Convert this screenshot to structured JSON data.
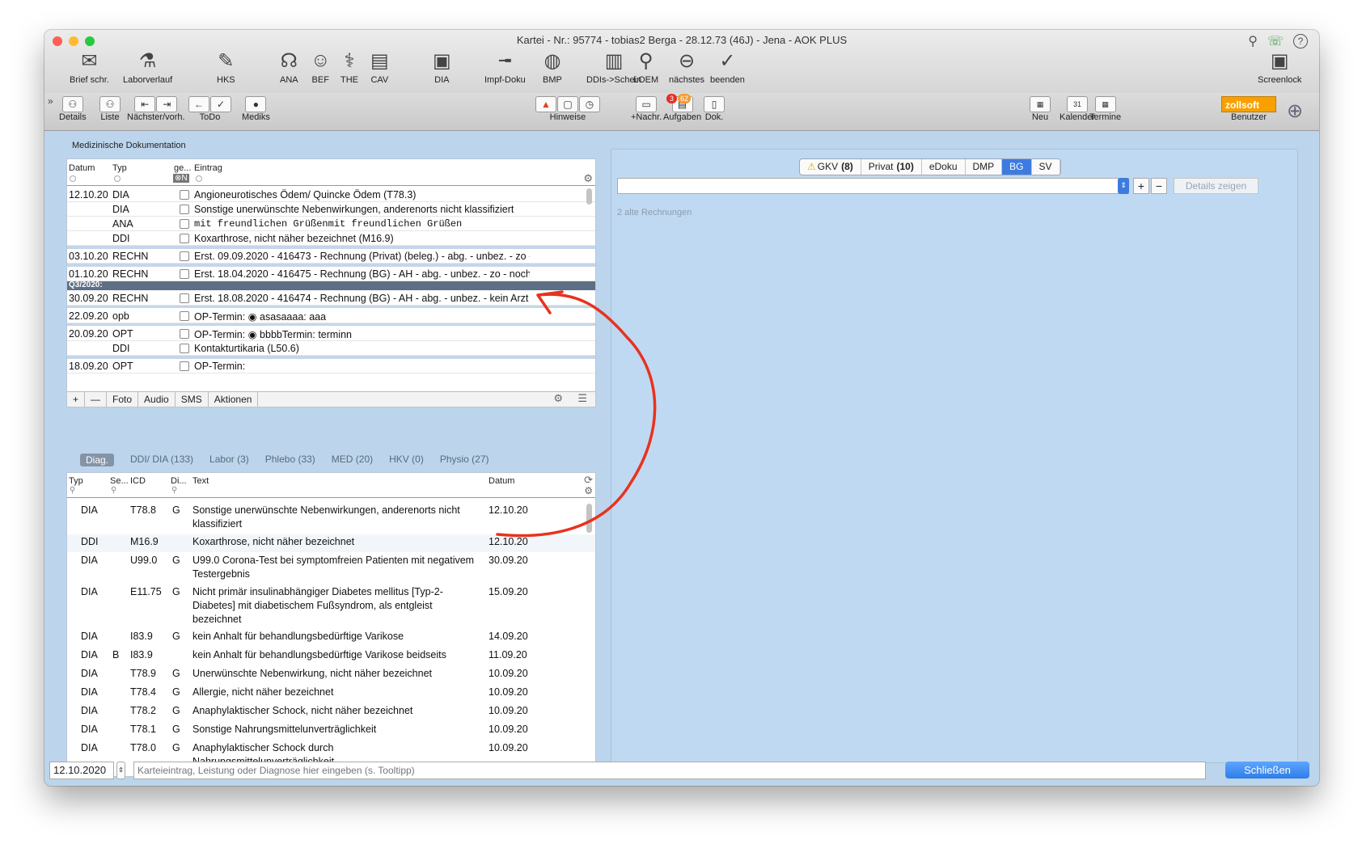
{
  "window": {
    "title": "Kartei - Nr.: 95774 - tobias2 Berga - 28.12.73 (46J) - Jena - AOK PLUS"
  },
  "toolbar": [
    {
      "label": "Brief schr.",
      "icon": "envelope-plus-icon",
      "glyph": "✉"
    },
    {
      "label": "Laborverlauf",
      "icon": "flask-icon",
      "glyph": "⚗"
    },
    {
      "label": "HKS",
      "icon": "pen-document-icon",
      "glyph": "✎"
    },
    {
      "label": "ANA",
      "icon": "stethoscope-icon",
      "glyph": "☊"
    },
    {
      "label": "BEF",
      "icon": "doctor-icon",
      "glyph": "☺"
    },
    {
      "label": "THE",
      "icon": "treatment-icon",
      "glyph": "⚕"
    },
    {
      "label": "CAV",
      "icon": "register-icon",
      "glyph": "▤"
    },
    {
      "label": "DIA",
      "icon": "clipboard-icon",
      "glyph": "▣"
    },
    {
      "label": "Impf-Doku",
      "icon": "syringe-icon",
      "glyph": "╼"
    },
    {
      "label": "BMP",
      "icon": "pill-icon",
      "glyph": "◍"
    },
    {
      "label": "DDIs->Schein",
      "icon": "document-icon",
      "glyph": "▥"
    },
    {
      "label": "LOEM",
      "icon": "microscope-icon",
      "glyph": "⚲"
    },
    {
      "label": "nächstes",
      "icon": "arrow-left-circle-icon",
      "glyph": "⊖"
    },
    {
      "label": "beenden",
      "icon": "check-circle-icon",
      "glyph": "✓"
    }
  ],
  "screenlock": {
    "label": "Screenlock",
    "glyph": "▣"
  },
  "toolbar2": [
    {
      "label": "Details",
      "glyphs": [
        "⚇"
      ]
    },
    {
      "label": "Liste",
      "glyphs": [
        "⚇"
      ]
    },
    {
      "label": "Nächster/vorh.",
      "glyphs": [
        "⇤",
        "⇥"
      ]
    },
    {
      "label": "ToDo",
      "glyphs": [
        "←",
        "✓"
      ]
    },
    {
      "label": "Mediks",
      "glyphs": [
        "●"
      ]
    },
    {
      "label": "Hinweise",
      "glyphs": [
        "▲",
        "▢",
        "◷"
      ]
    },
    {
      "label": "+Nachr.",
      "glyphs": [
        "▭"
      ]
    },
    {
      "label": "Aufgaben",
      "glyphs": [
        "▤"
      ]
    },
    {
      "label": "Dok.",
      "glyphs": [
        "▯"
      ]
    }
  ],
  "badges": {
    "nachr": "3",
    "aufgaben": "62"
  },
  "toolbar2_right": [
    {
      "label": "Neu",
      "glyph": "▦"
    },
    {
      "label": "Kalender",
      "glyph": "31"
    },
    {
      "label": "Termine",
      "glyph": "▦"
    }
  ],
  "benutzer": {
    "name": "zollsoft",
    "label": "Benutzer"
  },
  "left_panel": {
    "title": "Medizinische Dokumentation",
    "columns": {
      "datum": "Datum",
      "typ": "Typ",
      "ge": "ge...",
      "entry": "Eintrag",
      "filter": "⊗N"
    },
    "rows": [
      {
        "date": "12.10.20",
        "typ": "DIA",
        "text": "Angioneurotisches Ödem/ Quincke Ödem (T78.3)",
        "mono": false
      },
      {
        "date": "",
        "typ": "DIA",
        "text": "Sonstige unerwünschte Nebenwirkungen, anderenorts nicht klassifiziert",
        "mono": false
      },
      {
        "date": "",
        "typ": "ANA",
        "text": "mit freundlichen Grüßenmit freundlichen Grüßen",
        "mono": true
      },
      {
        "date": "",
        "typ": "DDI",
        "text": "Koxarthrose, nicht näher bezeichnet (M16.9)",
        "mono": false
      },
      {
        "date": "03.10.20",
        "typ": "RECHN",
        "text": "Erst. 09.09.2020 - 416473 - Rechnung (Privat) (beleg.) - abg. - unbez. - zo -",
        "mono": false
      },
      {
        "date": "01.10.20",
        "typ": "RECHN",
        "text": "Erst. 18.04.2020 - 416475 - Rechnung (BG) - AH - abg. - unbez. - zo - noch",
        "mono": false
      },
      {
        "date": "30.09.20",
        "typ": "RECHN",
        "text": "Erst. 18.08.2020 - 416474 - Rechnung (BG) - AH - abg. - unbez. - kein Arzt -",
        "mono": false
      },
      {
        "date": "22.09.20",
        "typ": "opb",
        "text": "OP-Termin: ◉ asasaaaa: aaa",
        "mono": false
      },
      {
        "date": "20.09.20",
        "typ": "OPT",
        "text": "OP-Termin: ◉ bbbbTermin: terminn",
        "mono": false
      },
      {
        "date": "",
        "typ": "DDI",
        "text": "Kontakturtikaria (L50.6)",
        "mono": false
      },
      {
        "date": "18.09.20",
        "typ": "OPT",
        "text": "OP-Termin:",
        "mono": false
      }
    ],
    "quarter_label": "Q3/2020:",
    "bottom_bar": [
      "+",
      "—",
      "Foto",
      "Audio",
      "SMS",
      "Aktionen"
    ]
  },
  "diag_tabs": [
    "Diag.",
    "DDI/ DIA (133)",
    "Labor (3)",
    "Phlebo (33)",
    "MED (20)",
    "HKV (0)",
    "Physio (27)"
  ],
  "diag_table": {
    "columns": {
      "typ": "Typ",
      "se": "Se...",
      "icd": "ICD",
      "di": "Di...",
      "text": "Text",
      "datum": "Datum"
    },
    "rows": [
      {
        "typ": "DIA",
        "se": "",
        "icd": "T78.8",
        "di": "G",
        "text": "Sonstige unerwünschte Nebenwirkungen, anderenorts nicht klassifiziert",
        "date": "12.10.20",
        "lines": 2,
        "hl": false
      },
      {
        "typ": "DDI",
        "se": "",
        "icd": "M16.9",
        "di": "",
        "text": "Koxarthrose, nicht näher bezeichnet",
        "date": "12.10.20",
        "lines": 1,
        "hl": true
      },
      {
        "typ": "DIA",
        "se": "",
        "icd": "U99.0",
        "di": "G",
        "text": "U99.0 Corona-Test bei symptomfreien Patienten mit negativem Testergebnis",
        "date": "30.09.20",
        "lines": 2,
        "hl": false
      },
      {
        "typ": "DIA",
        "se": "",
        "icd": "E11.75",
        "di": "G",
        "text": "Nicht primär insulinabhängiger Diabetes mellitus [Typ-2-Diabetes] mit diabetischem Fußsyndrom, als entgleist bezeichnet",
        "date": "15.09.20",
        "lines": 3,
        "hl": false
      },
      {
        "typ": "DIA",
        "se": "",
        "icd": "I83.9",
        "di": "G",
        "text": "kein Anhalt für  behandlungsbedürftige Varikose",
        "date": "14.09.20",
        "lines": 1,
        "hl": false
      },
      {
        "typ": "DIA",
        "se": "B",
        "icd": "I83.9",
        "di": "",
        "text": "kein Anhalt für  behandlungsbedürftige Varikose beidseits",
        "date": "11.09.20",
        "lines": 1,
        "hl": false
      },
      {
        "typ": "DIA",
        "se": "",
        "icd": "T78.9",
        "di": "G",
        "text": "Unerwünschte Nebenwirkung, nicht näher bezeichnet",
        "date": "10.09.20",
        "lines": 1,
        "hl": false
      },
      {
        "typ": "DIA",
        "se": "",
        "icd": "T78.4",
        "di": "G",
        "text": "Allergie, nicht näher bezeichnet",
        "date": "10.09.20",
        "lines": 1,
        "hl": false
      },
      {
        "typ": "DIA",
        "se": "",
        "icd": "T78.2",
        "di": "G",
        "text": "Anaphylaktischer Schock, nicht näher bezeichnet",
        "date": "10.09.20",
        "lines": 1,
        "hl": false
      },
      {
        "typ": "DIA",
        "se": "",
        "icd": "T78.1",
        "di": "G",
        "text": "Sonstige Nahrungsmittelunverträglichkeit",
        "date": "10.09.20",
        "lines": 1,
        "hl": false
      },
      {
        "typ": "DIA",
        "se": "",
        "icd": "T78.0",
        "di": "G",
        "text": "Anaphylaktischer Schock durch Nahrungsmittelunverträglichkeit",
        "date": "10.09.20",
        "lines": 2,
        "hl": false
      }
    ]
  },
  "right_panel": {
    "tabs": [
      {
        "label": "GKV",
        "count": "(8)",
        "warn": true
      },
      {
        "label": "Privat",
        "count": "(10)",
        "warn": false
      },
      {
        "label": "eDoku",
        "count": "",
        "warn": false
      },
      {
        "label": "DMP",
        "count": "",
        "warn": false
      },
      {
        "label": "BG",
        "count": "",
        "warn": false,
        "active": true
      },
      {
        "label": "SV",
        "count": "",
        "warn": false
      }
    ],
    "details_button": "Details zeigen",
    "info": "2 alte Rechnungen"
  },
  "footer": {
    "date": "12.10.2020",
    "placeholder": "Karteieintrag, Leistung oder Diagnose hier eingeben (s. Tooltipp)",
    "close": "Schließen"
  },
  "colors": {
    "accent": "#3d7be0",
    "annotation": "#e8321e",
    "window_bg": "#bcd5ec",
    "orange": "#f7a000"
  }
}
